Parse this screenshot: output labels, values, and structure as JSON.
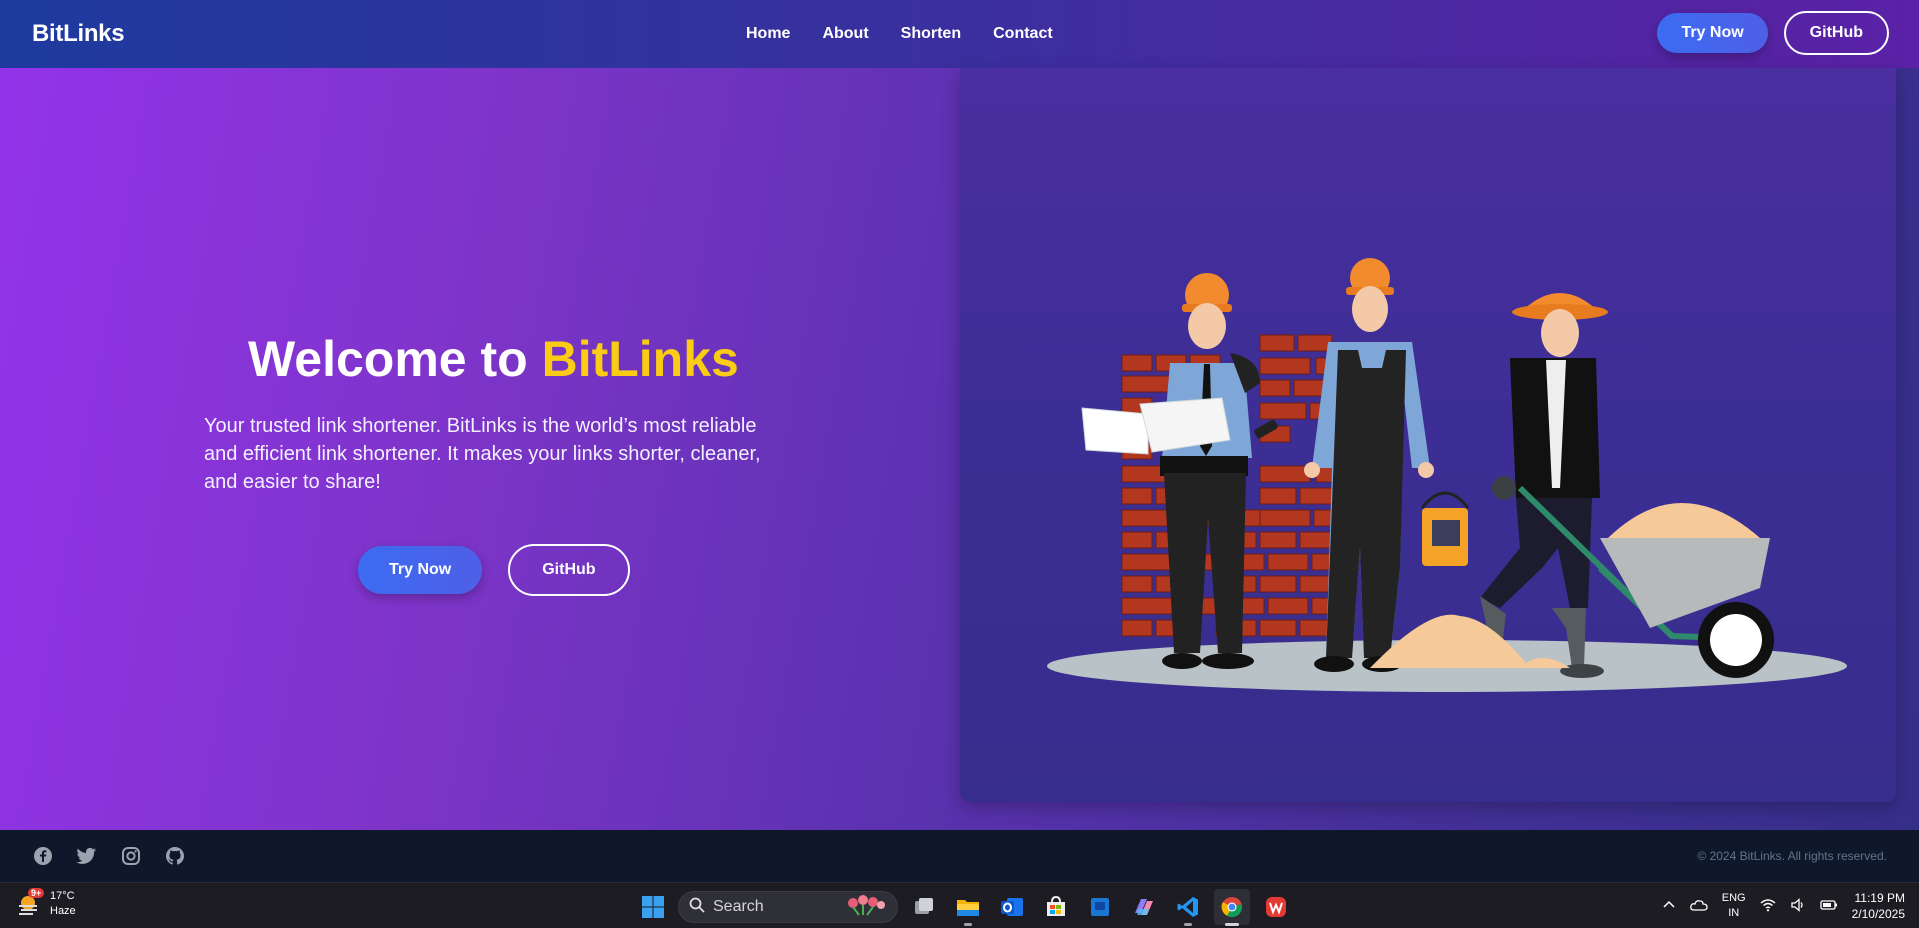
{
  "navbar": {
    "brand": "BitLinks",
    "links": [
      "Home",
      "About",
      "Shorten",
      "Contact"
    ],
    "try_now": "Try Now",
    "github": "GitHub"
  },
  "hero": {
    "title_prefix": "Welcome to ",
    "title_accent": "BitLinks",
    "description": "Your trusted link shortener. BitLinks is the world’s most reliable and efficient link shortener. It makes your links shorter, cleaner, and easier to share!",
    "try_now": "Try Now",
    "github": "GitHub",
    "illustration": "construction-workers-illustration"
  },
  "footer": {
    "social_icons": [
      "facebook-icon",
      "twitter-icon",
      "instagram-icon",
      "github-icon"
    ],
    "copyright": "© 2024 BitLinks. All rights reserved."
  },
  "taskbar": {
    "weather_temp": "17°C",
    "weather_desc": "Haze",
    "weather_badge": "9+",
    "search_placeholder": "Search",
    "lang_line1": "ENG",
    "lang_line2": "IN",
    "time": "11:19 PM",
    "date": "2/10/2025"
  },
  "colors": {
    "accent": "#facc15",
    "hero_start": "#9333ea",
    "hero_end": "#362f8a",
    "button": "#3b6cf2"
  }
}
